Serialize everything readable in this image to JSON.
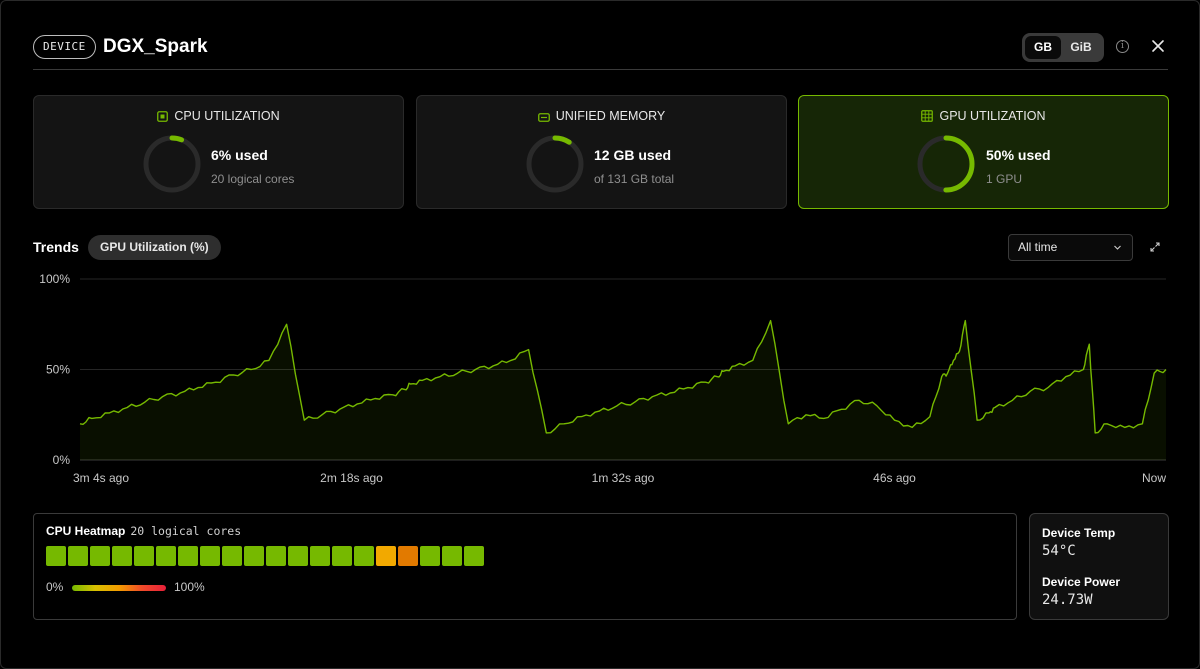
{
  "header": {
    "badge": "DEVICE",
    "device_name": "DGX_Spark",
    "unit_options": [
      "GB",
      "GiB"
    ],
    "selected_unit": "GB",
    "info_icon": "info-icon",
    "close_icon": "close-icon"
  },
  "cards": {
    "cpu": {
      "title": "CPU UTILIZATION",
      "icon": "cpu-icon",
      "value": "6% used",
      "sub": "20 logical cores",
      "fraction": 0.06
    },
    "memory": {
      "title": "UNIFIED MEMORY",
      "icon": "memory-icon",
      "value": "12  GB used",
      "sub": "of 131 GB total",
      "fraction": 0.092
    },
    "gpu": {
      "title": "GPU UTILIZATION",
      "icon": "gpu-icon",
      "value": "50% used",
      "sub": "1 GPU",
      "fraction": 0.5
    }
  },
  "trends": {
    "label": "Trends",
    "metric": "GPU Utilization (%)",
    "range": "All time",
    "expand_icon": "expand-icon"
  },
  "chart_data": {
    "type": "area",
    "y_ticks": [
      "100%",
      "50%",
      "0%"
    ],
    "x_ticks": [
      "3m 4s ago",
      "2m 18s ago",
      "1m 32s ago",
      "46s ago",
      "Now"
    ],
    "ylim": [
      0,
      100
    ],
    "xlim": [
      -184,
      0
    ],
    "color": "#76b900",
    "series": [
      {
        "x": [
          -184,
          -182,
          -179,
          -176,
          -173,
          -170,
          -167,
          -164,
          -161,
          -158,
          -155,
          -152,
          -149,
          -146,
          -143,
          -140,
          -137,
          -134,
          -131,
          -129,
          -128,
          -126,
          -123,
          -120,
          -117,
          -114,
          -111,
          -108,
          -105,
          -102,
          -99,
          -96,
          -93,
          -90,
          -87,
          -84,
          -81,
          -78,
          -76,
          -75,
          -73,
          -70,
          -67,
          -64,
          -61,
          -58,
          -55,
          -52,
          -49,
          -46,
          -43,
          -40,
          -38,
          -37,
          -36,
          -35,
          -34,
          -32,
          -30,
          -29,
          -26,
          -23,
          -20,
          -17,
          -14,
          -13,
          -12,
          -10,
          -7,
          -4,
          -2,
          0
        ],
        "y": [
          20,
          23,
          26,
          29,
          32,
          35,
          37,
          40,
          43,
          47,
          50,
          55,
          75,
          22,
          25,
          28,
          31,
          34,
          36,
          39,
          42,
          44,
          46,
          48,
          50,
          52,
          55,
          61,
          15,
          20,
          24,
          27,
          30,
          32,
          35,
          37,
          40,
          43,
          46,
          49,
          52,
          55,
          77,
          20,
          25,
          23,
          28,
          33,
          30,
          22,
          18,
          24,
          46,
          48,
          55,
          60,
          77,
          22,
          26,
          29,
          33,
          38,
          40,
          46,
          50,
          64,
          15,
          20,
          18,
          20,
          48,
          50
        ],
        "note_shape_samples": true
      }
    ]
  },
  "heatmap": {
    "title": "CPU Heatmap",
    "subtitle": "20 logical cores",
    "legend_min": "0%",
    "legend_max": "100%",
    "cells": [
      0.08,
      0.07,
      0.09,
      0.06,
      0.08,
      0.07,
      0.06,
      0.08,
      0.09,
      0.07,
      0.06,
      0.08,
      0.07,
      0.06,
      0.08,
      0.45,
      0.55,
      0.07,
      0.06,
      0.08
    ],
    "cell_colors": [
      "#76b900",
      "#76b900",
      "#76b900",
      "#76b900",
      "#76b900",
      "#76b900",
      "#76b900",
      "#76b900",
      "#76b900",
      "#76b900",
      "#76b900",
      "#76b900",
      "#76b900",
      "#76b900",
      "#76b900",
      "#f2a900",
      "#e27a00",
      "#76b900",
      "#76b900",
      "#76b900"
    ]
  },
  "stats": {
    "temp_label": "Device Temp",
    "temp_value": "54°C",
    "power_label": "Device Power",
    "power_value": "24.73W"
  }
}
